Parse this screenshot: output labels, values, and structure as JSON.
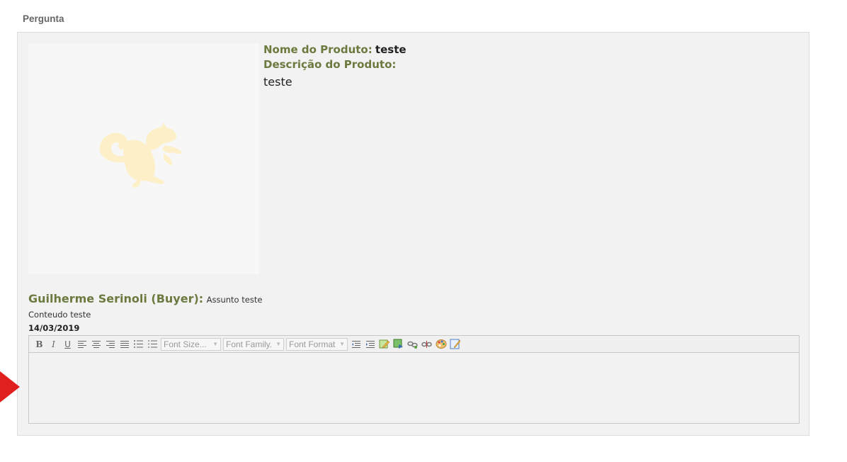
{
  "section": {
    "title": "Pergunta"
  },
  "product": {
    "name_label": "Nome do Produto:",
    "name_value": "teste",
    "description_label": "Descrição do Produto:",
    "description_value": "teste"
  },
  "question": {
    "author": "Guilherme Serinoli (Buyer):",
    "subject": "Assunto teste",
    "content": "Conteudo teste",
    "date": "14/03/2019"
  },
  "editor": {
    "bold": "B",
    "italic": "I",
    "underline": "U",
    "font_size": "Font Size...",
    "font_family": "Font Family.",
    "font_format": "Font Format"
  },
  "colors": {
    "label_green": "#6b7a3f",
    "placeholder_image": "#fdf0c8",
    "arrow_red": "#e0201e"
  }
}
